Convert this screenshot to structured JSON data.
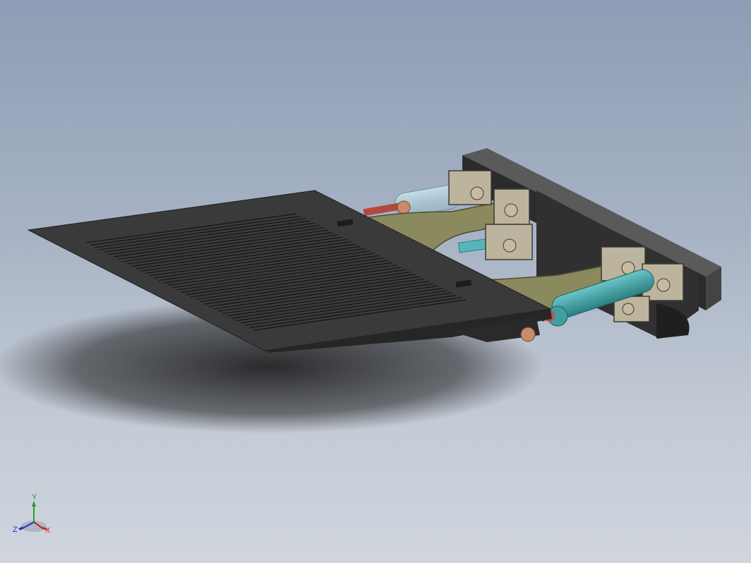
{
  "viewport": {
    "background_top": "#8e9db5",
    "background_bottom": "#d0d5de"
  },
  "model": {
    "colors": {
      "plate": "#3a3a3a",
      "plate_light": "#4a4a4a",
      "backplate": "#2e2e2e",
      "bracket": "#bdb49d",
      "arm": "#8a8a5e",
      "cylinder_glass": "#9ec9d6",
      "cylinder_teal": "#3e9ea0",
      "rod_red": "#b04a3e",
      "pin": "#c98b6b"
    }
  },
  "triad": {
    "x_label": "X",
    "y_label": "Y",
    "z_label": "Z",
    "x_color": "#d02020",
    "y_color": "#20a020",
    "z_color": "#2030c0"
  }
}
